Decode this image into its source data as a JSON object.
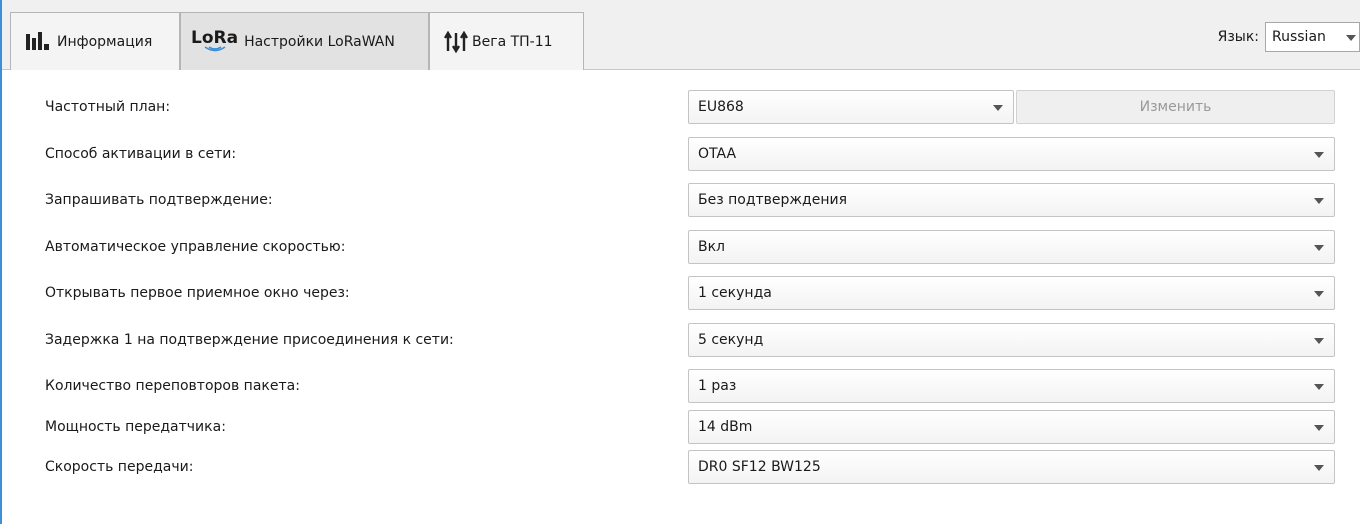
{
  "tabs": [
    {
      "label": "Информация",
      "icon": "bar-chart-icon"
    },
    {
      "label": "Настройки LoRaWAN",
      "icon": "lora-icon",
      "icon_text": "LoRa"
    },
    {
      "label": "Вега ТП-11",
      "icon": "arrows-icon"
    }
  ],
  "language": {
    "label": "Язык:",
    "value": "Russian"
  },
  "settings": [
    {
      "label": "Частотный план:",
      "value": "EU868",
      "button": "Изменить"
    },
    {
      "label": "Способ активации в сети:",
      "value": "OTAA"
    },
    {
      "label": "Запрашивать подтверждение:",
      "value": "Без подтверждения"
    },
    {
      "label": "Автоматическое управление скоростью:",
      "value": "Вкл"
    },
    {
      "label": "Открывать первое приемное окно через:",
      "value": "1 секунда"
    },
    {
      "label": "Задержка 1 на подтверждение присоединения к сети:",
      "value": "5 секунд"
    },
    {
      "label": "Количество переповторов пакета:",
      "value": "1 раз"
    },
    {
      "label": "Мощность передатчика:",
      "value": "14 dBm"
    },
    {
      "label": "Скорость передачи:",
      "value": "DR0 SF12 BW125"
    }
  ],
  "colors": {
    "accent": "#3d8fd9",
    "lora_blue": "#3d8fd9",
    "disabled_text": "#9a9a9a"
  }
}
